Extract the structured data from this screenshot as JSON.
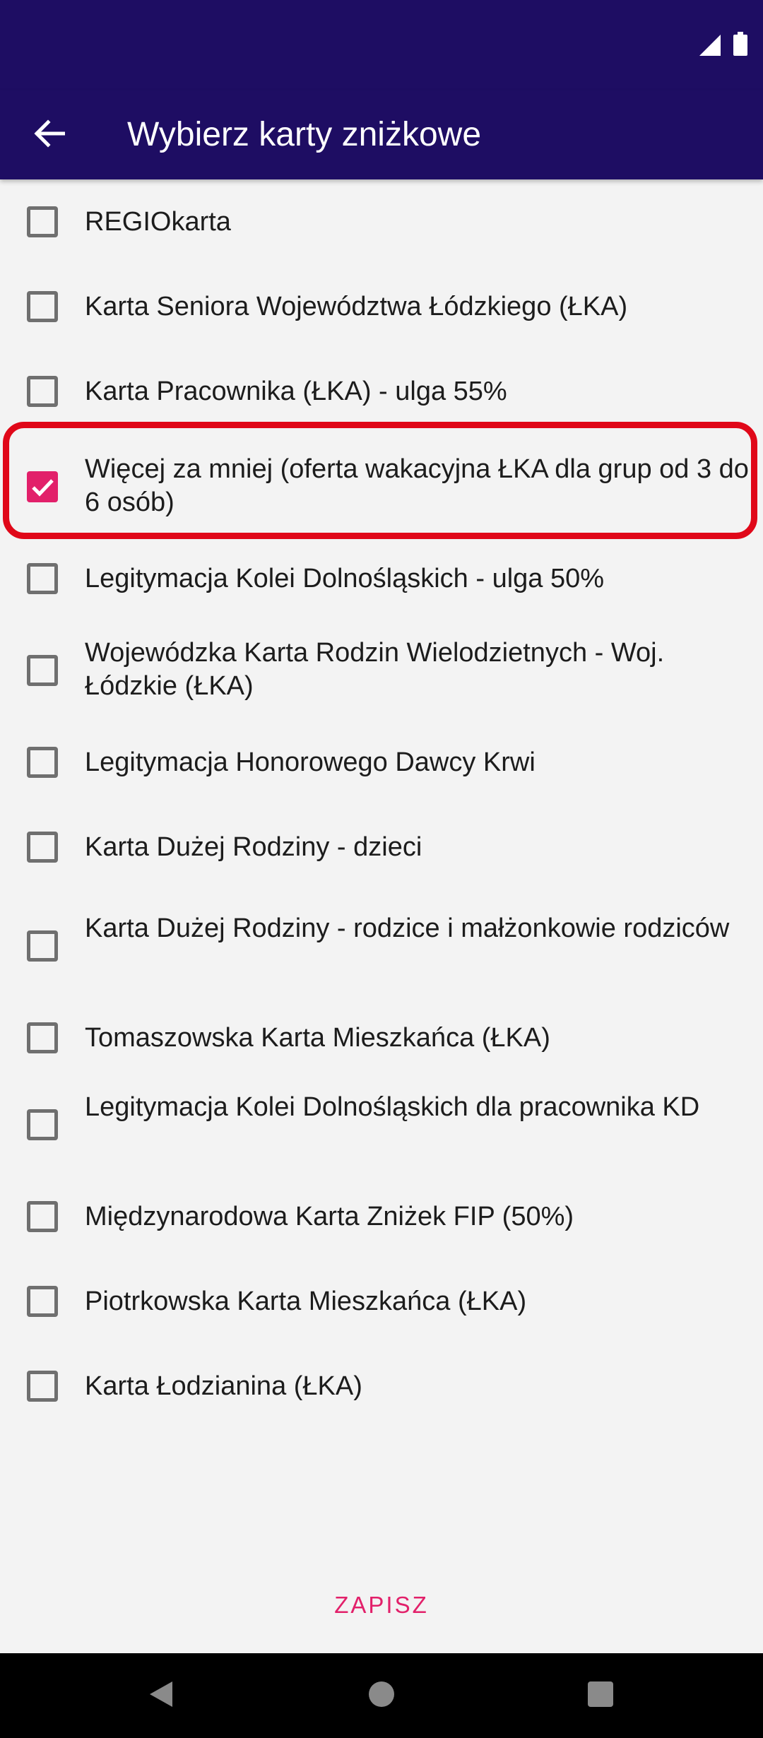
{
  "status_bar": {
    "icons": [
      "signal-icon",
      "battery-icon"
    ]
  },
  "toolbar": {
    "title": "Wybierz karty zniżkowe",
    "back_icon": "arrow-back-icon"
  },
  "colors": {
    "primary": "#1e0d63",
    "accent": "#e2206a",
    "highlight": "#e00819"
  },
  "cards": [
    {
      "label": "REGIOkarta",
      "checked": false
    },
    {
      "label": "Karta Seniora Województwa Łódzkiego (ŁKA)",
      "checked": false
    },
    {
      "label": "Karta Pracownika (ŁKA) - ulga 55%",
      "checked": false
    },
    {
      "label": "Więcej za mniej (oferta wakacyjna ŁKA dla grup od 3 do 6 osób)",
      "checked": true
    },
    {
      "label": "Legitymacja Kolei Dolnośląskich - ulga 50%",
      "checked": false
    },
    {
      "label": "Wojewódzka Karta Rodzin Wielodzietnych - Woj. Łódzkie (ŁKA)",
      "checked": false
    },
    {
      "label": "Legitymacja Honorowego Dawcy Krwi",
      "checked": false
    },
    {
      "label": "Karta Dużej Rodziny - dzieci",
      "checked": false
    },
    {
      "label": "Karta Dużej Rodziny - rodzice i małżonkowie rodziców",
      "checked": false
    },
    {
      "label": "Tomaszowska Karta Mieszkańca (ŁKA)",
      "checked": false
    },
    {
      "label": "Legitymacja Kolei Dolnośląskich dla pracownika KD",
      "checked": false
    },
    {
      "label": "Międzynarodowa Karta Zniżek FIP (50%)",
      "checked": false
    },
    {
      "label": "Piotrkowska Karta Mieszkańca (ŁKA)",
      "checked": false
    },
    {
      "label": "Karta Łodzianina (ŁKA)",
      "checked": false
    }
  ],
  "actions": {
    "save_label": "ZAPISZ"
  },
  "nav_bar": {
    "icons": [
      "back-triangle-icon",
      "home-circle-icon",
      "recents-square-icon"
    ]
  }
}
